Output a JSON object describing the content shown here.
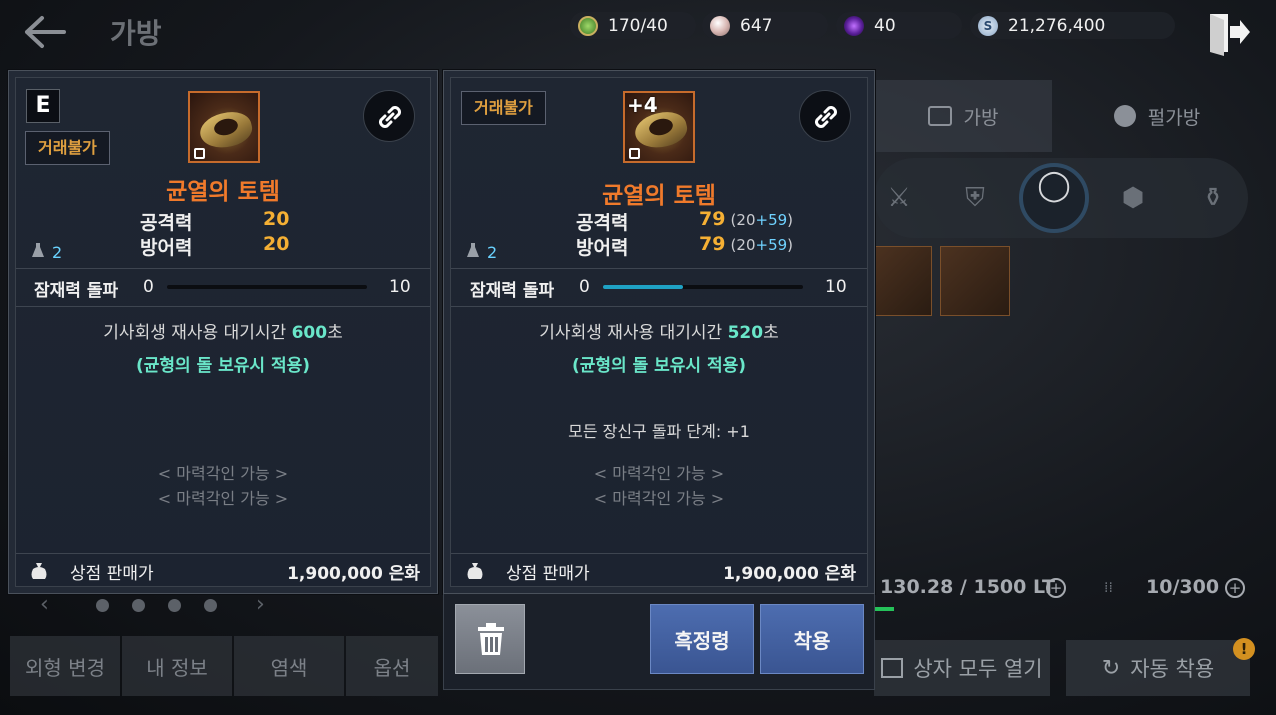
{
  "header": {
    "title": "가방",
    "currencies": [
      {
        "icon": "leaf-icon",
        "value": "170/40",
        "color": "#5fae3a"
      },
      {
        "icon": "pearl-icon",
        "value": "647",
        "color": "#d9b8b4"
      },
      {
        "icon": "dark-orb-icon",
        "value": "40",
        "color": "#7a3cd0"
      },
      {
        "icon": "silver-coin-icon",
        "value": "21,276,400",
        "color": "#9fb9d8"
      }
    ]
  },
  "bag": {
    "tabs": [
      "가방",
      "펄가방"
    ],
    "weight": "130.28 / 1500 LT",
    "slots": "10/300",
    "open_all": "상자 모두 열기",
    "auto_equip": "자동 착용",
    "notif": "!"
  },
  "bottom_menu": [
    "외형 변경",
    "내 정보",
    "염색",
    "옵션"
  ],
  "left_card": {
    "grade": "E",
    "trade": "거래불가",
    "name": "균열의 토템",
    "stats": [
      {
        "name": "공격력",
        "value": "20"
      },
      {
        "name": "방어력",
        "value": "20"
      }
    ],
    "weight": "2",
    "potential_label": "잠재력 돌파",
    "potential_min": "0",
    "potential_max": "10",
    "potential_fill": 0,
    "effect_prefix": "기사회생 재사용 대기시간 ",
    "effect_value": "600",
    "effect_suffix": "초",
    "effect_note": "(균형의 돌 보유시 적용)",
    "runes": [
      "< 마력각인 가능 >",
      "< 마력각인 가능 >"
    ],
    "sell_label": "상점 판매가",
    "sell_value": "1,900,000 은화"
  },
  "right_card": {
    "trade": "거래불가",
    "enhance": "+4",
    "name": "균열의 토템",
    "stats": [
      {
        "name": "공격력",
        "value": "79",
        "base": "20",
        "bonus": "+59"
      },
      {
        "name": "방어력",
        "value": "79",
        "base": "20",
        "bonus": "+59"
      }
    ],
    "weight": "2",
    "potential_label": "잠재력 돌파",
    "potential_min": "0",
    "potential_max": "10",
    "potential_fill": 0.4,
    "effect_prefix": "기사회생 재사용 대기시간 ",
    "effect_value": "520",
    "effect_suffix": "초",
    "effect_note": "(균형의 돌 보유시 적용)",
    "all_accessory": "모든 장신구 돌파 단계: +1",
    "runes": [
      "< 마력각인 가능 >",
      "< 마력각인 가능 >"
    ],
    "sell_label": "상점 판매가",
    "sell_value": "1,900,000 은화"
  },
  "actions": {
    "seal": "흑정령",
    "equip": "착용"
  }
}
